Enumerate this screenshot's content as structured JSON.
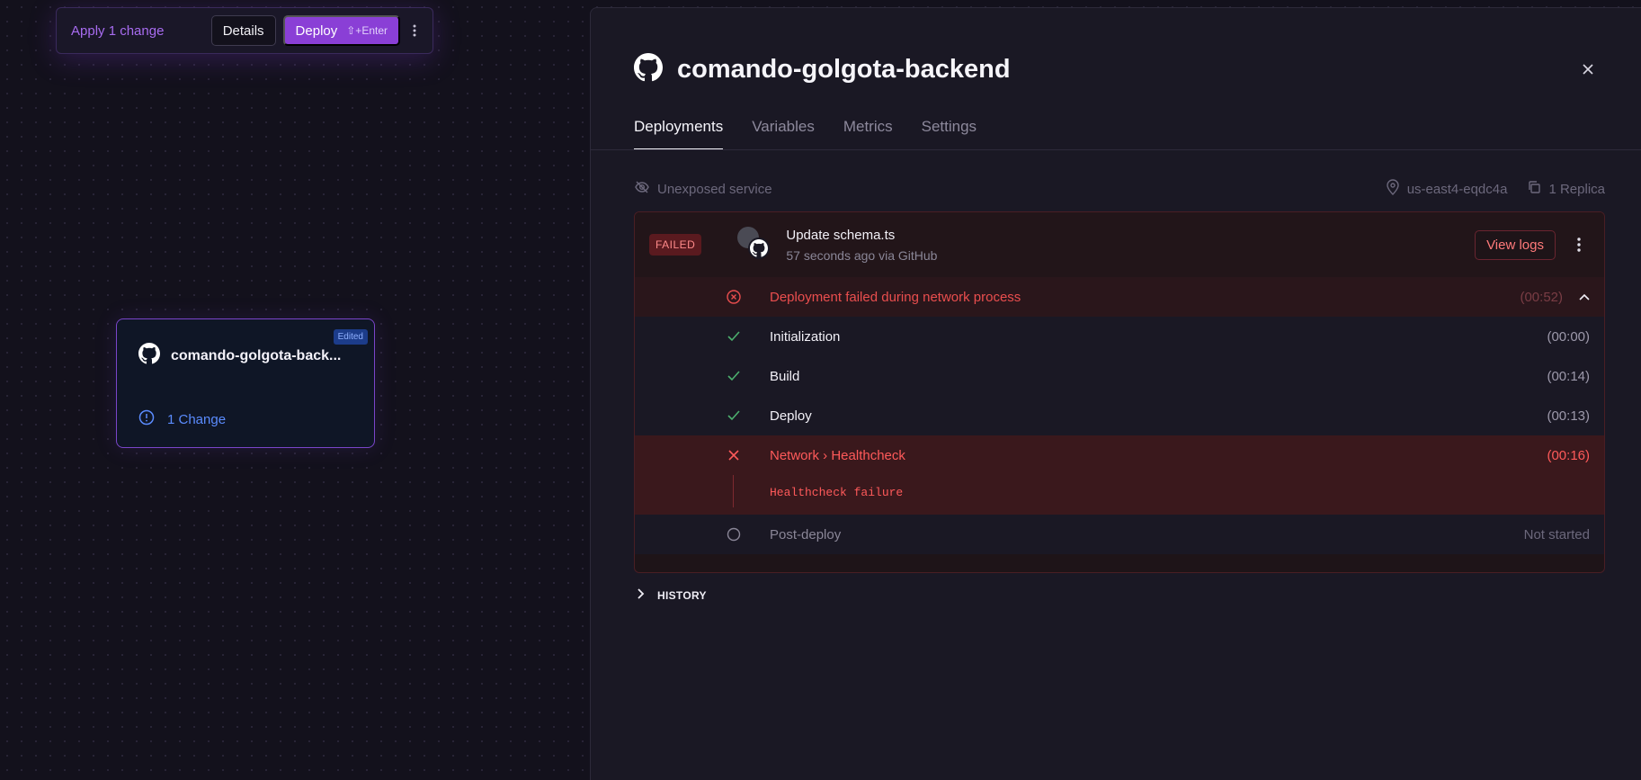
{
  "change_bar": {
    "apply_label": "Apply 1 change",
    "details_label": "Details",
    "deploy_label": "Deploy",
    "deploy_shortcut": "⇧+Enter"
  },
  "service_card": {
    "title": "comando-golgota-back...",
    "badge": "Edited",
    "change_text": "1 Change"
  },
  "panel": {
    "title": "comando-golgota-backend",
    "tabs": [
      "Deployments",
      "Variables",
      "Metrics",
      "Settings"
    ],
    "meta": {
      "exposure": "Unexposed service",
      "region": "us-east4-eqdc4a",
      "replicas": "1 Replica"
    },
    "deployment": {
      "status": "FAILED",
      "commit_message": "Update schema.ts",
      "commit_sub": "57 seconds ago via GitHub",
      "view_logs": "View logs",
      "summary": {
        "text": "Deployment failed during network process",
        "time": "(00:52)"
      },
      "steps": [
        {
          "name": "Initialization",
          "time": "(00:00)",
          "state": "success"
        },
        {
          "name": "Build",
          "time": "(00:14)",
          "state": "success"
        },
        {
          "name": "Deploy",
          "time": "(00:13)",
          "state": "success"
        },
        {
          "name": "Network › Healthcheck",
          "time": "(00:16)",
          "state": "failed",
          "detail": "Healthcheck failure"
        },
        {
          "name": "Post-deploy",
          "time": "Not started",
          "state": "pending"
        }
      ]
    },
    "history_label": "HISTORY"
  },
  "colors": {
    "accent": "#8a3fd6",
    "error": "#ff5a5a",
    "success": "#4caf6e",
    "link": "#5b8cff"
  }
}
